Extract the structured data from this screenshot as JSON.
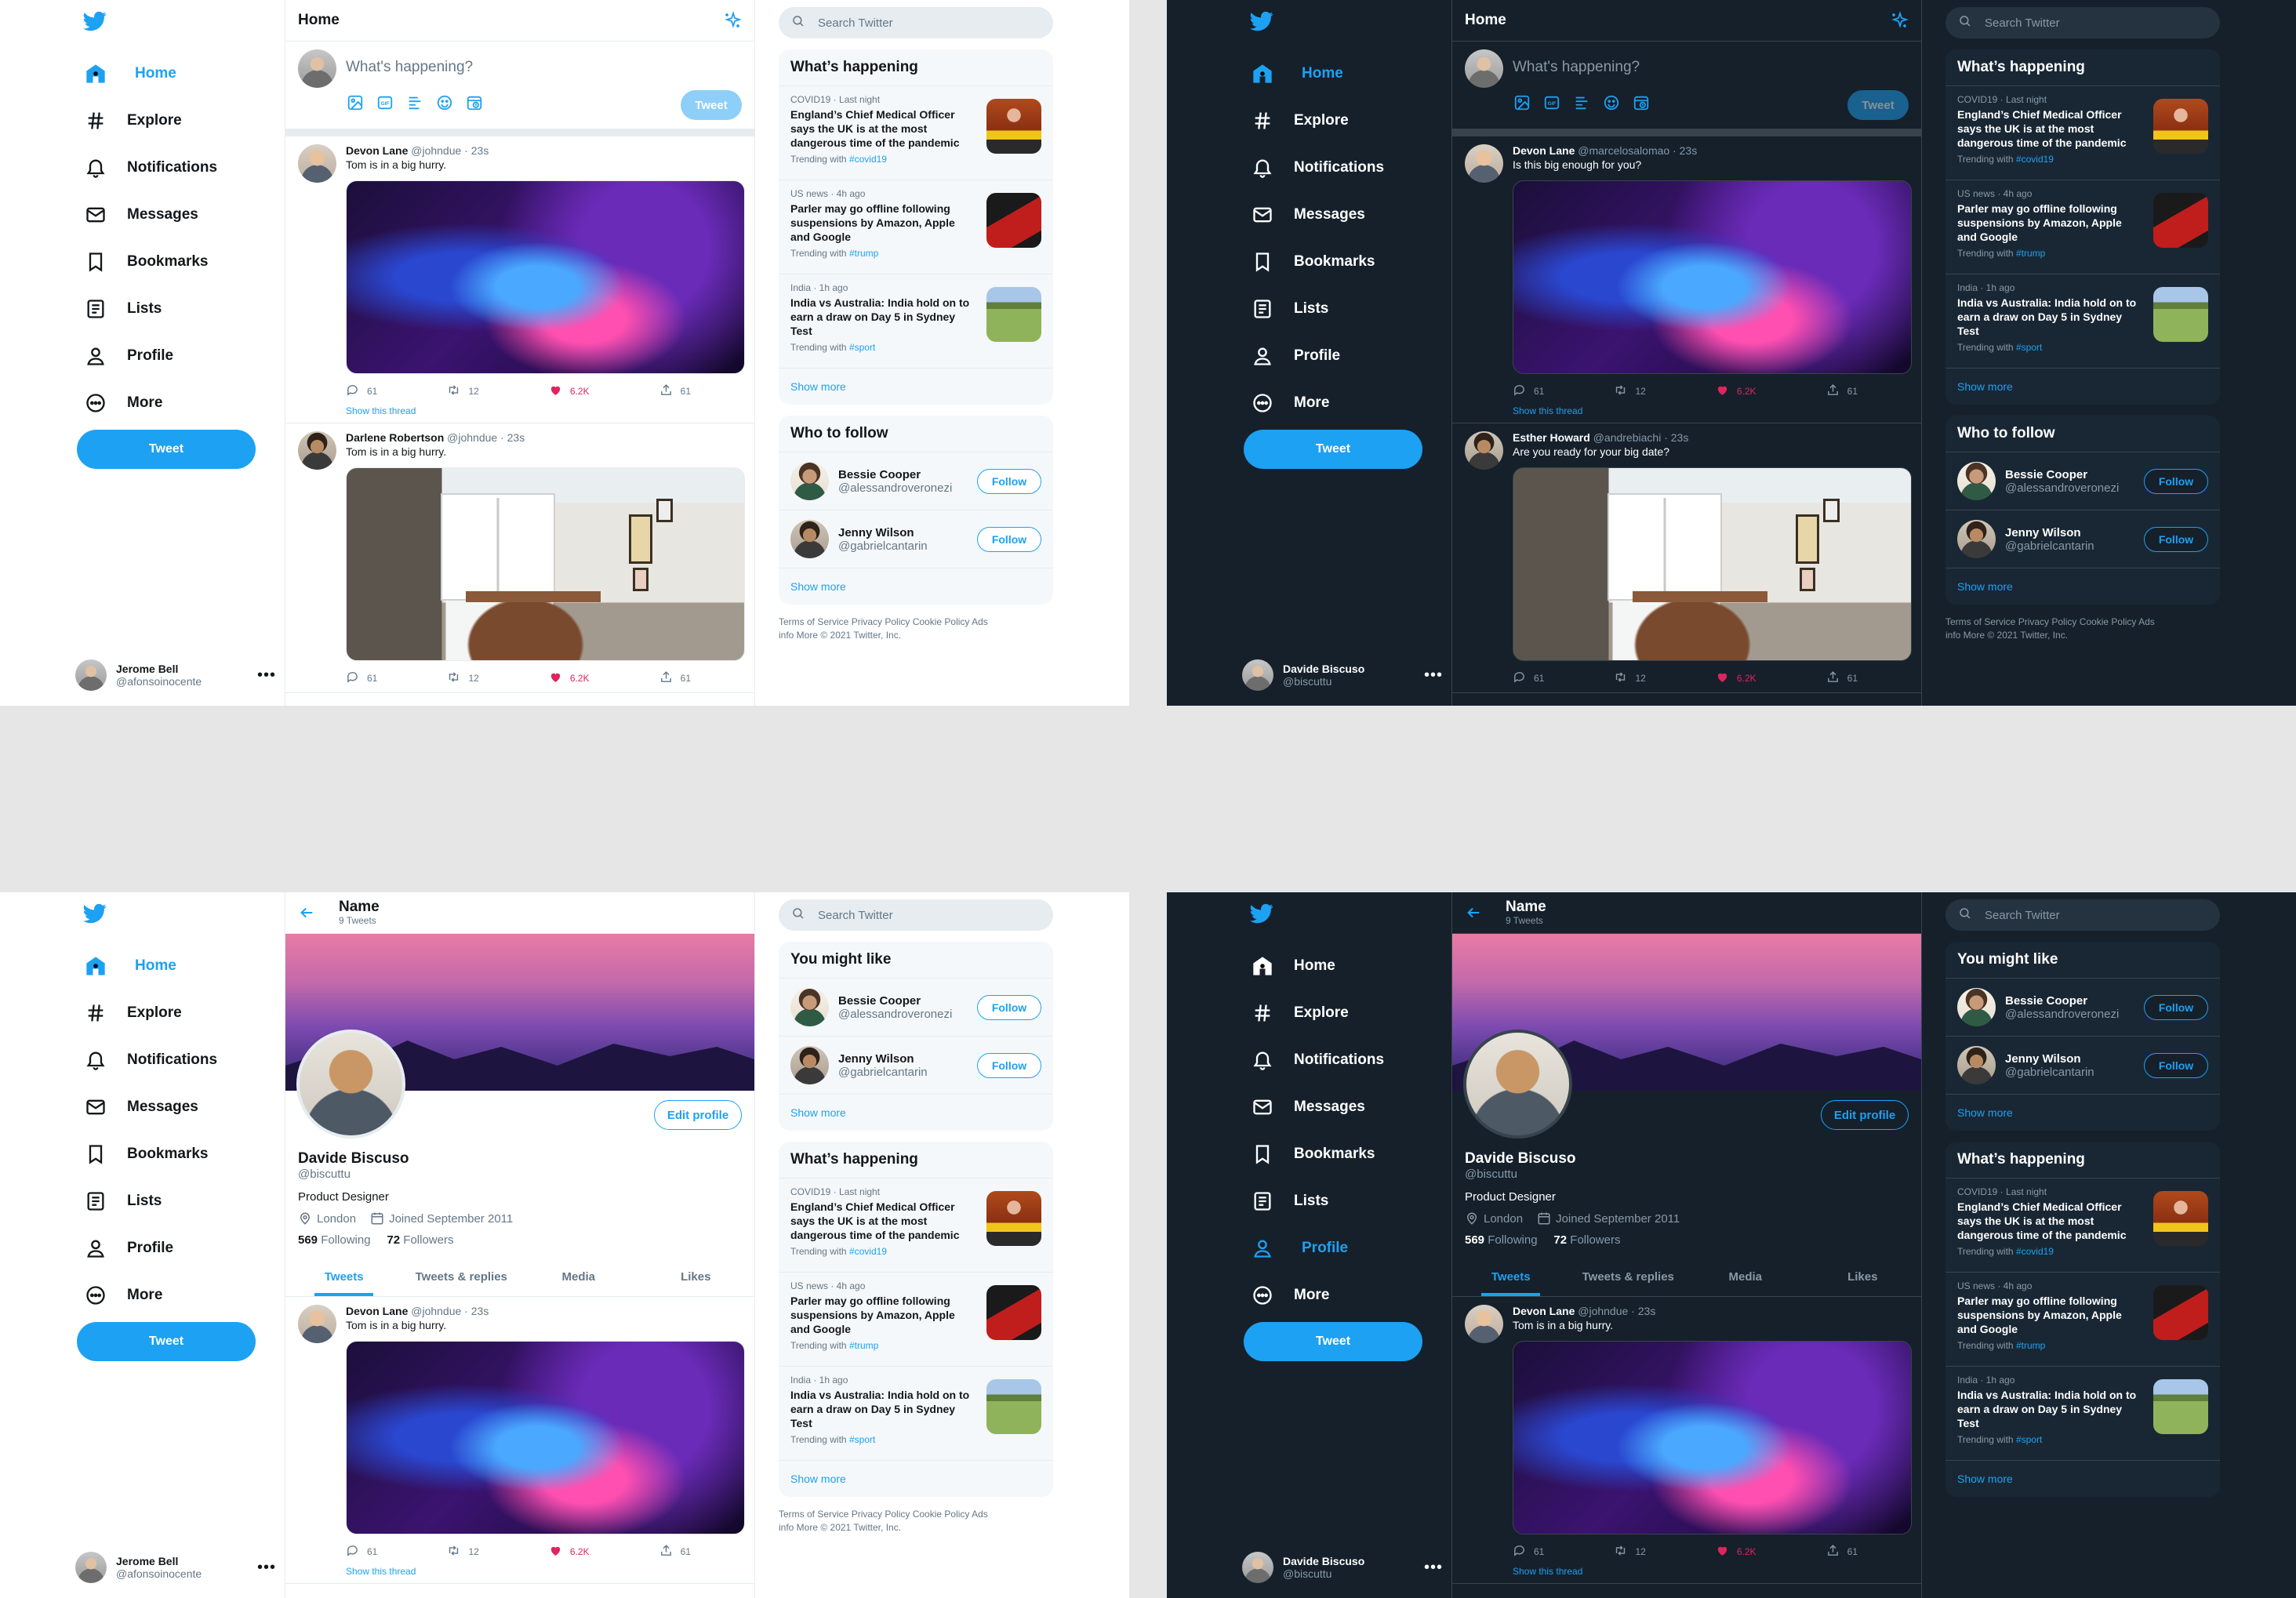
{
  "brand": {
    "accent": "#1da1f2",
    "like": "#e0245e",
    "light_bg": "#ffffff",
    "dark_bg": "#15202b",
    "canvas_bg": "#e6e6e6"
  },
  "nav": [
    {
      "label": "Home",
      "icon": "home-icon"
    },
    {
      "label": "Explore",
      "icon": "hashtag-icon"
    },
    {
      "label": "Notifications",
      "icon": "bell-icon"
    },
    {
      "label": "Messages",
      "icon": "envelope-icon"
    },
    {
      "label": "Bookmarks",
      "icon": "bookmark-icon"
    },
    {
      "label": "Lists",
      "icon": "list-icon"
    },
    {
      "label": "Profile",
      "icon": "person-icon"
    },
    {
      "label": "More",
      "icon": "more-circle-icon"
    }
  ],
  "tweet_button": "Tweet",
  "accounts": {
    "light": {
      "name": "Jerome Bell",
      "handle": "@afonsoinocente"
    },
    "dark": {
      "name": "Davide Biscuso",
      "handle": "@biscuttu"
    }
  },
  "home": {
    "title": "Home",
    "compose_placeholder": "What's happening?",
    "compose_button": "Tweet"
  },
  "tweets_light": [
    {
      "name": "Devon Lane",
      "handle": "@johndue",
      "time": "23s",
      "text": "Tom is in a big hurry.",
      "replies": "61",
      "retweets": "12",
      "likes": "6.2K",
      "shares": "61",
      "media": "art",
      "thread": "Show this thread"
    },
    {
      "name": "Darlene Robertson",
      "handle": "@johndue",
      "time": "23s",
      "text": "Tom is in a big hurry.",
      "replies": "61",
      "retweets": "12",
      "likes": "6.2K",
      "shares": "61",
      "media": "room",
      "thread": ""
    }
  ],
  "tweets_dark": [
    {
      "name": "Devon Lane",
      "handle": "@marcelosalomao",
      "time": "23s",
      "text": "Is this big enough for you?",
      "replies": "61",
      "retweets": "12",
      "likes": "6.2K",
      "shares": "61",
      "media": "art",
      "thread": "Show this thread"
    },
    {
      "name": "Esther Howard",
      "handle": "@andrebiachi",
      "time": "23s",
      "text": "Are you ready for your big date?",
      "replies": "61",
      "retweets": "12",
      "likes": "6.2K",
      "shares": "61",
      "media": "room",
      "thread": ""
    }
  ],
  "search_placeholder": "Search Twitter",
  "trends": {
    "title": "What’s happening",
    "items": [
      {
        "meta": "COVID19 · Last night",
        "title": "England’s Chief Medical Officer says the UK is at the most dangerous time of the pandemic",
        "with": "Trending with",
        "tag": "#covid19"
      },
      {
        "meta": "US news · 4h ago",
        "title": "Parler may go offline following suspensions by Amazon, Apple and Google",
        "with": "Trending with",
        "tag": "#trump"
      },
      {
        "meta": "India · 1h ago",
        "title": "India vs Australia: India hold on to earn a draw on Day 5 in Sydney Test",
        "with": "Trending with",
        "tag": "#sport"
      }
    ],
    "show_more": "Show more"
  },
  "who_to_follow": {
    "title": "Who to follow",
    "alt_title": "You might like",
    "items": [
      {
        "name": "Bessie Cooper",
        "handle": "@alessandroveronezi",
        "button": "Follow"
      },
      {
        "name": "Jenny Wilson",
        "handle": "@gabrielcantarin",
        "button": "Follow"
      }
    ],
    "show_more": "Show more"
  },
  "footer": "Terms of Service Privacy Policy Cookie Policy Ads info More © 2021 Twitter, Inc.",
  "profile": {
    "title": "Name",
    "tweet_count": "9 Tweets",
    "name": "Davide Biscuso",
    "handle": "@biscuttu",
    "bio": "Product Designer",
    "location": "London",
    "joined": "Joined September 2011",
    "following_count": "569",
    "following_label": "Following",
    "followers_count": "72",
    "followers_label": "Followers",
    "edit_button": "Edit profile",
    "tabs": [
      "Tweets",
      "Tweets & replies",
      "Media",
      "Likes"
    ]
  },
  "profile_tweets": [
    {
      "name": "Devon Lane",
      "handle": "@johndue",
      "time": "23s",
      "text": "Tom is in a big hurry.",
      "replies": "61",
      "retweets": "12",
      "likes": "6.2K",
      "shares": "61",
      "media": "art",
      "thread": "Show this thread"
    }
  ]
}
